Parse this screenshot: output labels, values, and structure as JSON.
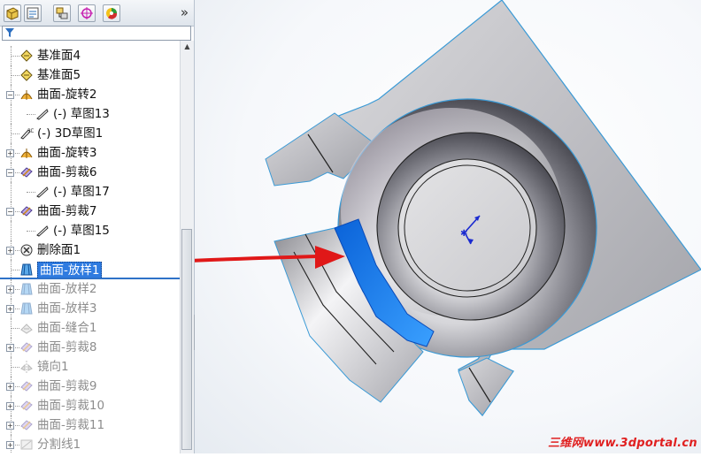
{
  "feature_tree": {
    "items": [
      {
        "label": "基准面4",
        "icon": "plane-icon",
        "state": "active",
        "expander": false,
        "indent": 0
      },
      {
        "label": "基准面5",
        "icon": "plane-icon",
        "state": "active",
        "expander": false,
        "indent": 0
      },
      {
        "label": "曲面-旋转2",
        "icon": "surface-revolve-icon",
        "state": "active",
        "expander": "minus",
        "indent": 0
      },
      {
        "label": "(-) 草图13",
        "icon": "sketch-icon",
        "state": "active",
        "expander": false,
        "indent": 1
      },
      {
        "label": "(-) 3D草图1",
        "icon": "3d-sketch-icon",
        "state": "active",
        "expander": false,
        "indent": 0
      },
      {
        "label": "曲面-旋转3",
        "icon": "surface-revolve-icon",
        "state": "active",
        "expander": "plus",
        "indent": 0
      },
      {
        "label": "曲面-剪裁6",
        "icon": "surface-trim-icon",
        "state": "active",
        "expander": "minus",
        "indent": 0
      },
      {
        "label": "(-) 草图17",
        "icon": "sketch-icon",
        "state": "active",
        "expander": false,
        "indent": 1
      },
      {
        "label": "曲面-剪裁7",
        "icon": "surface-trim-icon",
        "state": "active",
        "expander": "minus",
        "indent": 0
      },
      {
        "label": "(-) 草图15",
        "icon": "sketch-icon",
        "state": "active",
        "expander": false,
        "indent": 1
      },
      {
        "label": "删除面1",
        "icon": "delete-face-icon",
        "state": "active",
        "expander": "plus",
        "indent": 0
      },
      {
        "label": "曲面-放样1",
        "icon": "surface-loft-icon",
        "state": "selected",
        "expander": false,
        "indent": 0
      },
      {
        "label": "曲面-放样2",
        "icon": "surface-loft-icon",
        "state": "suppressed",
        "expander": "plus",
        "indent": 0
      },
      {
        "label": "曲面-放样3",
        "icon": "surface-loft-icon",
        "state": "suppressed",
        "expander": "plus",
        "indent": 0
      },
      {
        "label": "曲面-缝合1",
        "icon": "surface-knit-icon",
        "state": "suppressed",
        "expander": false,
        "indent": 0
      },
      {
        "label": "曲面-剪裁8",
        "icon": "surface-trim-icon",
        "state": "suppressed",
        "expander": "plus",
        "indent": 0
      },
      {
        "label": "镜向1",
        "icon": "mirror-icon",
        "state": "suppressed",
        "expander": false,
        "indent": 0
      },
      {
        "label": "曲面-剪裁9",
        "icon": "surface-trim-icon",
        "state": "suppressed",
        "expander": "plus",
        "indent": 0
      },
      {
        "label": "曲面-剪裁10",
        "icon": "surface-trim-icon",
        "state": "suppressed",
        "expander": "plus",
        "indent": 0
      },
      {
        "label": "曲面-剪裁11",
        "icon": "surface-trim-icon",
        "state": "suppressed",
        "expander": "plus",
        "indent": 0
      },
      {
        "label": "分割线1",
        "icon": "split-line-icon",
        "state": "suppressed",
        "expander": "plus",
        "indent": 0
      }
    ]
  },
  "panel_tabs": [
    "feature-manager-tab-icon",
    "property-manager-tab-icon",
    "configuration-manager-tab-icon",
    "dimxpert-tab-icon",
    "display-manager-tab-icon"
  ],
  "panel_expand_label": "»",
  "watermark": "三维网www.3dportal.cn",
  "colors": {
    "selection": "#2f7be0",
    "highlight_face": "#1e88ff",
    "annotation_arrow": "#e01818",
    "model_edge": "#3a9ad6",
    "watermark": "#e02020"
  }
}
